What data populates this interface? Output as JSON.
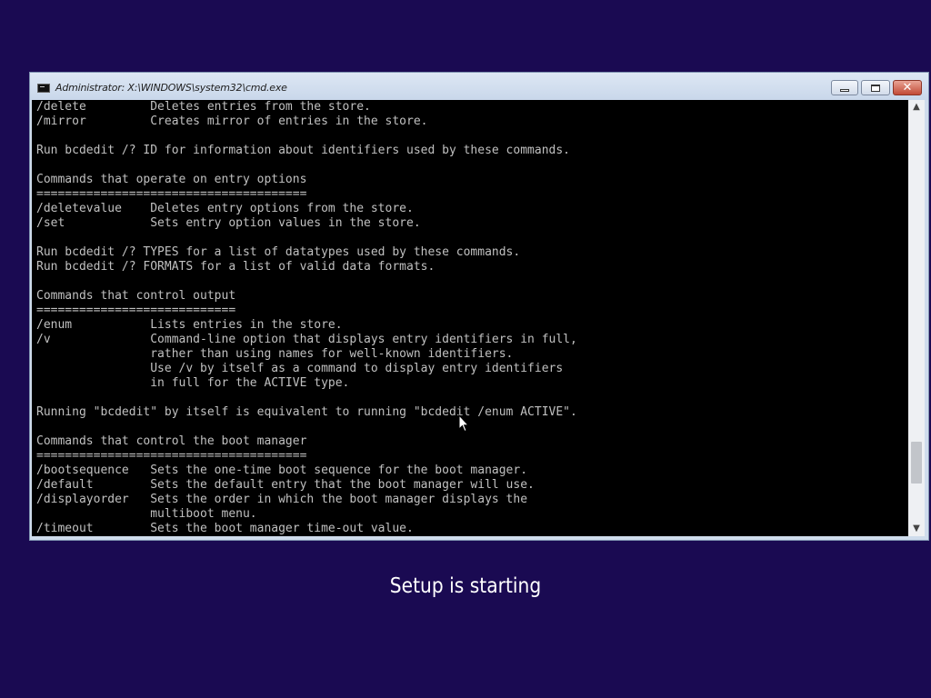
{
  "window": {
    "title": "Administrator: X:\\WINDOWS\\system32\\cmd.exe",
    "icon": "cmd-icon",
    "minimize_icon": "minimize-icon",
    "maximize_icon": "maximize-icon",
    "close_icon": "close-icon",
    "close_glyph": "✕",
    "close_color": "#c24a36"
  },
  "console": {
    "background": "#000000",
    "text_color": "#c0c0c0",
    "lines": [
      "/delete         Deletes entries from the store.",
      "/mirror         Creates mirror of entries in the store.",
      "",
      "Run bcdedit /? ID for information about identifiers used by these commands.",
      "",
      "Commands that operate on entry options",
      "======================================",
      "/deletevalue    Deletes entry options from the store.",
      "/set            Sets entry option values in the store.",
      "",
      "Run bcdedit /? TYPES for a list of datatypes used by these commands.",
      "Run bcdedit /? FORMATS for a list of valid data formats.",
      "",
      "Commands that control output",
      "============================",
      "/enum           Lists entries in the store.",
      "/v              Command-line option that displays entry identifiers in full,",
      "                rather than using names for well-known identifiers.",
      "                Use /v by itself as a command to display entry identifiers",
      "                in full for the ACTIVE type.",
      "",
      "Running \"bcdedit\" by itself is equivalent to running \"bcdedit /enum ACTIVE\".",
      "",
      "Commands that control the boot manager",
      "======================================",
      "/bootsequence   Sets the one-time boot sequence for the boot manager.",
      "/default        Sets the default entry that the boot manager will use.",
      "/displayorder   Sets the order in which the boot manager displays the",
      "                multiboot menu.",
      "/timeout        Sets the boot manager time-out value."
    ]
  },
  "scrollbar": {
    "up_arrow": "▲",
    "down_arrow": "▼"
  },
  "cursor": {
    "icon": "mouse-pointer-icon"
  },
  "setup": {
    "status": "Setup is starting",
    "background": "#1a0a52"
  }
}
